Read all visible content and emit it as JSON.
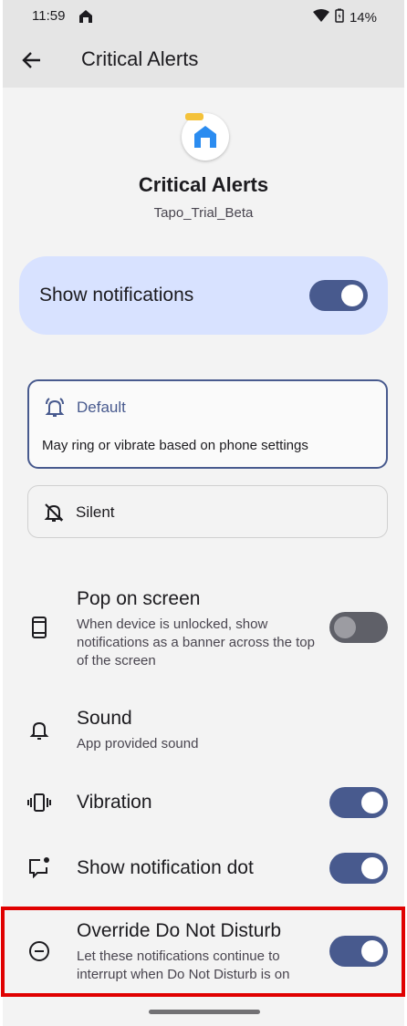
{
  "status_bar": {
    "time": "11:59",
    "battery": "14%"
  },
  "app_bar": {
    "title": "Critical Alerts"
  },
  "header": {
    "channel_name": "Critical Alerts",
    "app_name": "Tapo_Trial_Beta"
  },
  "show_notifications": {
    "label": "Show notifications",
    "enabled": true
  },
  "alert_options": {
    "default": {
      "title": "Default",
      "description": "May ring or vibrate based on phone settings",
      "selected": true
    },
    "silent": {
      "title": "Silent",
      "selected": false
    }
  },
  "settings": {
    "pop_on_screen": {
      "title": "Pop on screen",
      "subtitle": "When device is unlocked, show notifications as a banner across the top of the screen",
      "enabled": false
    },
    "sound": {
      "title": "Sound",
      "subtitle": "App provided sound"
    },
    "vibration": {
      "title": "Vibration",
      "enabled": true
    },
    "notification_dot": {
      "title": "Show notification dot",
      "enabled": true
    },
    "override_dnd": {
      "title": "Override Do Not Disturb",
      "subtitle": "Let these notifications continue to interrupt when Do Not Disturb is on",
      "enabled": true
    }
  },
  "colors": {
    "accent": "#485a8e",
    "card": "#d8e2ff",
    "background": "#f3f3f3",
    "highlight": "#e00000"
  }
}
